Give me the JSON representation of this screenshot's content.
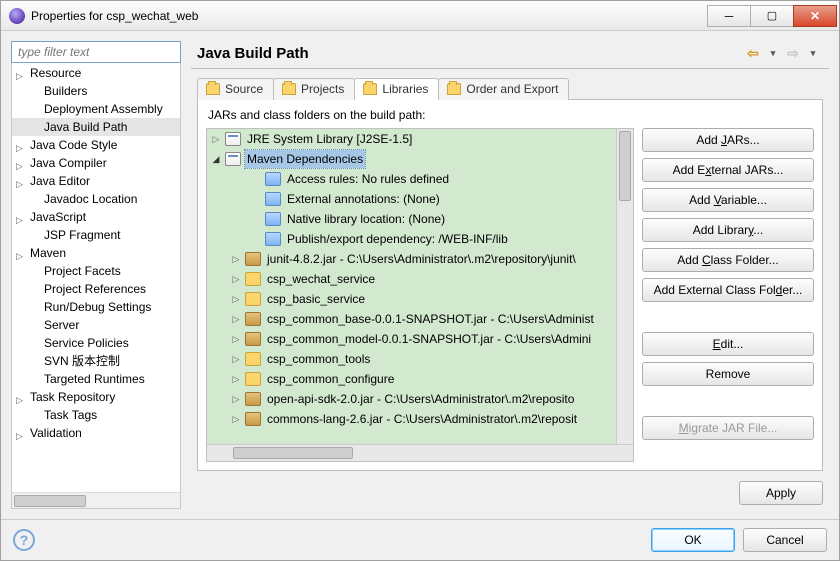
{
  "window": {
    "title": "Properties for csp_wechat_web"
  },
  "sidebar": {
    "filter_placeholder": "type filter text",
    "items": [
      {
        "label": "Resource",
        "expand": "closed",
        "indent": 0
      },
      {
        "label": "Builders",
        "indent": 1
      },
      {
        "label": "Deployment Assembly",
        "indent": 1
      },
      {
        "label": "Java Build Path",
        "indent": 1,
        "selected": true
      },
      {
        "label": "Java Code Style",
        "expand": "closed",
        "indent": 0
      },
      {
        "label": "Java Compiler",
        "expand": "closed",
        "indent": 0
      },
      {
        "label": "Java Editor",
        "expand": "closed",
        "indent": 0
      },
      {
        "label": "Javadoc Location",
        "indent": 1
      },
      {
        "label": "JavaScript",
        "expand": "closed",
        "indent": 0
      },
      {
        "label": "JSP Fragment",
        "indent": 1
      },
      {
        "label": "Maven",
        "expand": "closed",
        "indent": 0
      },
      {
        "label": "Project Facets",
        "indent": 1
      },
      {
        "label": "Project References",
        "indent": 1
      },
      {
        "label": "Run/Debug Settings",
        "indent": 1
      },
      {
        "label": "Server",
        "indent": 1
      },
      {
        "label": "Service Policies",
        "indent": 1
      },
      {
        "label": "SVN 版本控制",
        "indent": 1
      },
      {
        "label": "Targeted Runtimes",
        "indent": 1
      },
      {
        "label": "Task Repository",
        "expand": "closed",
        "indent": 0
      },
      {
        "label": "Task Tags",
        "indent": 1
      },
      {
        "label": "Validation",
        "expand": "closed",
        "indent": 0
      }
    ]
  },
  "main": {
    "title": "Java Build Path",
    "tabs": {
      "source": "Source",
      "projects": "Projects",
      "libraries": "Libraries",
      "order": "Order and Export"
    },
    "desc": "JARs and class folders on the build path:",
    "tree": [
      {
        "tw": "closed",
        "ind": 0,
        "icon": "lib",
        "label": "JRE System Library [J2SE-1.5]"
      },
      {
        "tw": "open",
        "ind": 0,
        "icon": "lib",
        "label": "Maven Dependencies",
        "selected": true
      },
      {
        "tw": "",
        "ind": 2,
        "icon": "rule",
        "label": "Access rules: No rules defined"
      },
      {
        "tw": "",
        "ind": 2,
        "icon": "rule",
        "label": "External annotations: (None)"
      },
      {
        "tw": "",
        "ind": 2,
        "icon": "rule",
        "label": "Native library location: (None)"
      },
      {
        "tw": "",
        "ind": 2,
        "icon": "rule",
        "label": "Publish/export dependency: /WEB-INF/lib"
      },
      {
        "tw": "closed",
        "ind": 1,
        "icon": "jar",
        "label": "junit-4.8.2.jar - C:\\Users\\Administrator\\.m2\\repository\\junit\\"
      },
      {
        "tw": "closed",
        "ind": 1,
        "icon": "folder",
        "label": "csp_wechat_service"
      },
      {
        "tw": "closed",
        "ind": 1,
        "icon": "folder",
        "label": "csp_basic_service"
      },
      {
        "tw": "closed",
        "ind": 1,
        "icon": "jar",
        "label": "csp_common_base-0.0.1-SNAPSHOT.jar - C:\\Users\\Administ"
      },
      {
        "tw": "closed",
        "ind": 1,
        "icon": "jar",
        "label": "csp_common_model-0.0.1-SNAPSHOT.jar - C:\\Users\\Admini"
      },
      {
        "tw": "closed",
        "ind": 1,
        "icon": "folder",
        "label": "csp_common_tools"
      },
      {
        "tw": "closed",
        "ind": 1,
        "icon": "folder",
        "label": "csp_common_configure"
      },
      {
        "tw": "closed",
        "ind": 1,
        "icon": "jar",
        "label": "open-api-sdk-2.0.jar - C:\\Users\\Administrator\\.m2\\reposito"
      },
      {
        "tw": "closed",
        "ind": 1,
        "icon": "jar",
        "label": "commons-lang-2.6.jar - C:\\Users\\Administrator\\.m2\\reposit"
      }
    ],
    "buttons": {
      "add_jars": "Add JARs...",
      "add_ext_jars": "Add External JARs...",
      "add_var": "Add Variable...",
      "add_lib": "Add Library...",
      "add_class": "Add Class Folder...",
      "add_ext_class": "Add External Class Folder...",
      "edit": "Edit...",
      "remove": "Remove",
      "migrate": "Migrate JAR File..."
    },
    "apply": "Apply"
  },
  "footer": {
    "ok": "OK",
    "cancel": "Cancel"
  }
}
